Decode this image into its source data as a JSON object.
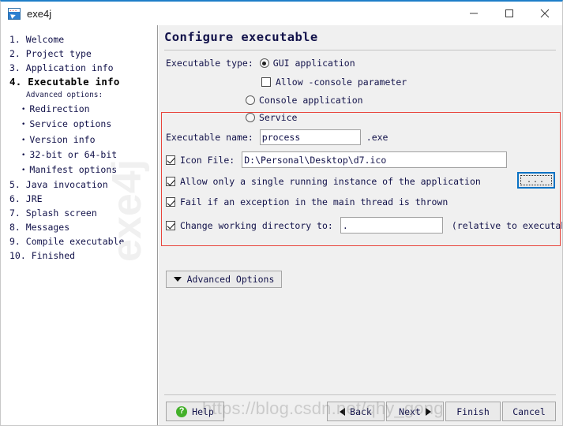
{
  "window": {
    "title": "exe4j",
    "icon": "exe4j-app-icon",
    "minimize": "minimize-icon",
    "maximize": "maximize-icon",
    "close": "close-icon"
  },
  "sidebar": {
    "items": [
      {
        "label": "1. Welcome",
        "type": "step",
        "current": false
      },
      {
        "label": "2. Project type",
        "type": "step",
        "current": false
      },
      {
        "label": "3. Application info",
        "type": "step",
        "current": false
      },
      {
        "label": "4. Executable info",
        "type": "step",
        "current": true
      },
      {
        "label": "Advanced options:",
        "type": "subhead",
        "current": false
      },
      {
        "label": "Redirection",
        "type": "bullet",
        "current": false
      },
      {
        "label": "Service options",
        "type": "bullet",
        "current": false
      },
      {
        "label": "Version info",
        "type": "bullet",
        "current": false
      },
      {
        "label": "32-bit or 64-bit",
        "type": "bullet",
        "current": false
      },
      {
        "label": "Manifest options",
        "type": "bullet",
        "current": false
      },
      {
        "label": "5. Java invocation",
        "type": "step",
        "current": false
      },
      {
        "label": "6. JRE",
        "type": "step",
        "current": false
      },
      {
        "label": "7. Splash screen",
        "type": "step",
        "current": false
      },
      {
        "label": "8. Messages",
        "type": "step",
        "current": false
      },
      {
        "label": "9. Compile executable",
        "type": "step",
        "current": false
      },
      {
        "label": "10. Finished",
        "type": "step",
        "current": false
      }
    ],
    "watermark": "exe4j"
  },
  "main": {
    "title": "Configure executable",
    "exec_type_label": "Executable type:",
    "radio_gui": "GUI application",
    "radio_gui_selected": true,
    "checkbox_allow_console": "Allow -console parameter",
    "checkbox_allow_console_checked": false,
    "radio_console": "Console application",
    "radio_console_selected": false,
    "radio_service": "Service",
    "radio_service_selected": false,
    "exec_name_label": "Executable name:",
    "exec_name_value": "process",
    "exec_name_suffix": ".exe",
    "icon_file_label": "Icon File:",
    "icon_file_checked": true,
    "icon_file_value": "D:\\Personal\\Desktop\\d7.ico",
    "browse_label": "...",
    "checkbox_single_instance": "Allow only a single running instance of the application",
    "checkbox_single_instance_checked": true,
    "checkbox_fail_exception": "Fail if an exception in the main thread is thrown",
    "checkbox_fail_exception_checked": true,
    "checkbox_change_workdir": "Change working directory to:",
    "checkbox_change_workdir_checked": true,
    "workdir_value": ".",
    "workdir_hint": "(relative to executable)",
    "advanced_options_label": "Advanced Options"
  },
  "buttons": {
    "help": "Help",
    "back": "Back",
    "next": "Next",
    "finish": "Finish",
    "cancel": "Cancel"
  },
  "watermark": {
    "url": "https://blog.csdn.net/qhy_gong"
  },
  "colors": {
    "accent": "#1e7ec8",
    "panel": "#f0f0f0",
    "annotation": "#e8453c",
    "help_green": "#43b02a",
    "focus_blue": "#0a72c4"
  }
}
